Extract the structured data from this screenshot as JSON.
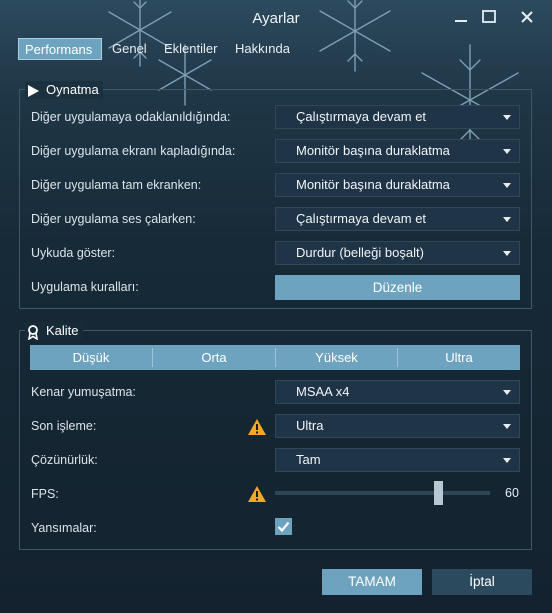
{
  "window": {
    "title": "Ayarlar",
    "controls": [
      "minimize-icon",
      "maximize-icon",
      "close-icon"
    ]
  },
  "tabs": [
    {
      "label": "Performans",
      "active": true
    },
    {
      "label": "Genel",
      "active": false
    },
    {
      "label": "Eklentiler",
      "active": false
    },
    {
      "label": "Hakkında",
      "active": false
    }
  ],
  "playback": {
    "title": "Oynatma",
    "icon": "play-icon",
    "rows": [
      {
        "label": "Diğer uygulamaya odaklanıldığında:",
        "value": "Çalıştırmaya devam et"
      },
      {
        "label": "Diğer uygulama ekranı kapladığında:",
        "value": "Monitör başına duraklatma"
      },
      {
        "label": "Diğer uygulama tam ekranken:",
        "value": "Monitör başına duraklatma"
      },
      {
        "label": "Diğer uygulama ses çalarken:",
        "value": "Çalıştırmaya devam et"
      },
      {
        "label": "Uykuda göster:",
        "value": "Durdur (belleği boşalt)"
      }
    ],
    "rules_label": "Uygulama kuralları:",
    "rules_button": "Düzenle"
  },
  "quality": {
    "title": "Kalite",
    "icon": "award-icon",
    "presets": [
      "Düşük",
      "Orta",
      "Yüksek",
      "Ultra"
    ],
    "antialias_label": "Kenar yumuşatma:",
    "antialias_value": "MSAA x4",
    "postprocess_label": "Son işleme:",
    "postprocess_value": "Ultra",
    "resolution_label": "Çözünürlük:",
    "resolution_value": "Tam",
    "fps_label": "FPS:",
    "fps_value": "60",
    "fps_fraction": 0.76,
    "reflections_label": "Yansımalar:",
    "reflections_checked": true,
    "warning_icon": "warning-icon"
  },
  "footer": {
    "ok": "TAMAM",
    "cancel": "İptal"
  },
  "colors": {
    "accent": "#6ea3bf",
    "warning": "#f5a623"
  }
}
